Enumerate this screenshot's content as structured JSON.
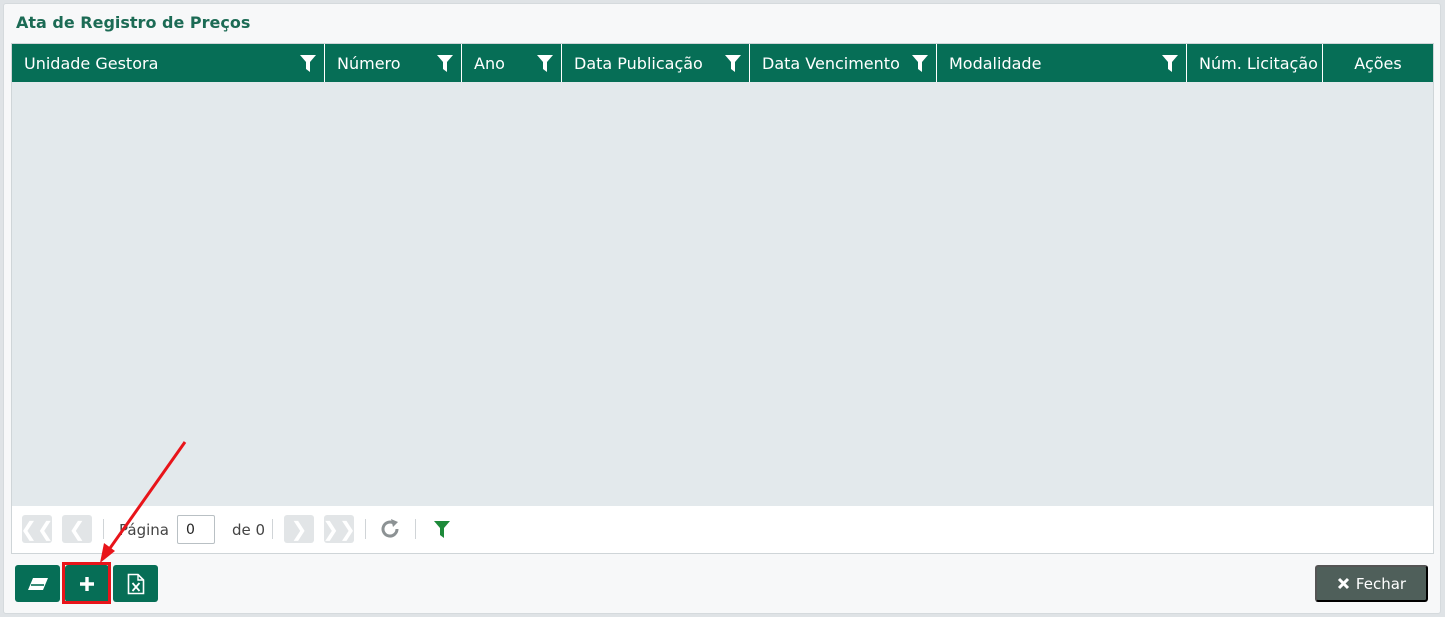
{
  "panel": {
    "title": "Ata de Registro de Preços"
  },
  "grid": {
    "columns": [
      {
        "label": "Unidade Gestora",
        "filter": true
      },
      {
        "label": "Número",
        "filter": true
      },
      {
        "label": "Ano",
        "filter": true
      },
      {
        "label": "Data Publicação",
        "filter": true
      },
      {
        "label": "Data Vencimento",
        "filter": true
      },
      {
        "label": "Modalidade",
        "filter": true
      },
      {
        "label": "Núm. Licitação",
        "filter": false
      },
      {
        "label": "Ações",
        "filter": false
      }
    ],
    "rows": []
  },
  "pager": {
    "page_label": "Página",
    "page_value": "0",
    "total_label": "de 0"
  },
  "actions": {
    "close_label": "Fechar"
  },
  "icons": {
    "clear": "eraser-icon",
    "add": "plus-icon",
    "export": "excel-file-icon",
    "close": "x-icon",
    "refresh": "refresh-icon",
    "filter": "filter-icon"
  },
  "colors": {
    "brand": "#066e56",
    "highlight": "#e8141a"
  }
}
